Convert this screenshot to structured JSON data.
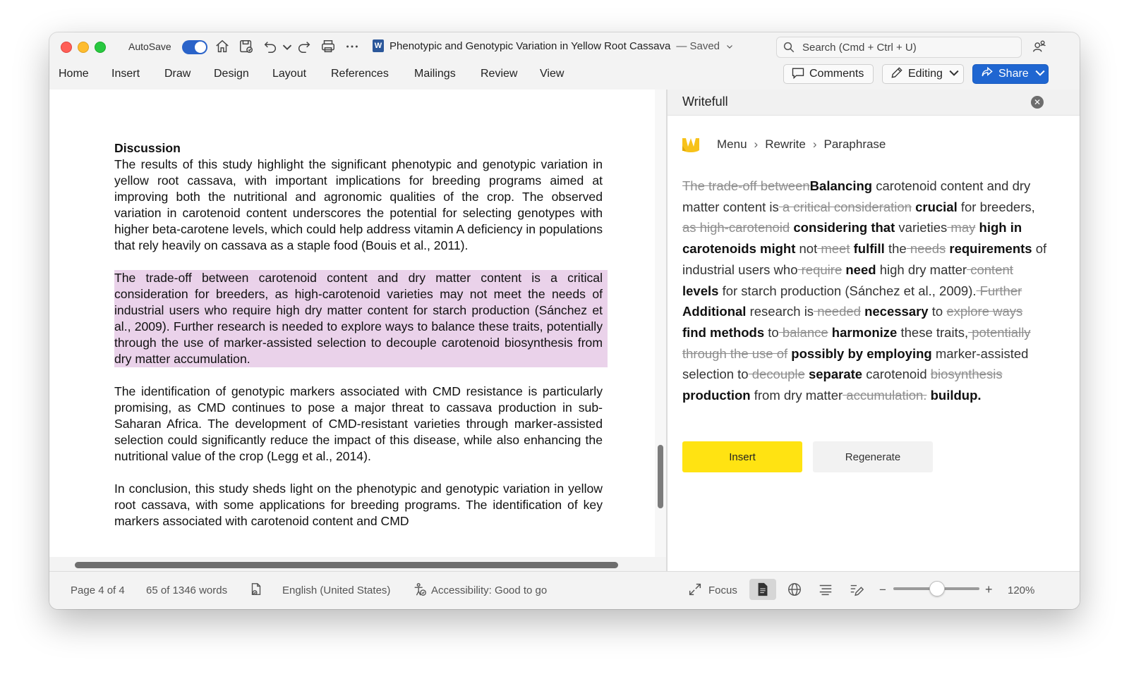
{
  "titlebar": {
    "autosave_label": "AutoSave",
    "document_title": "Phenotypic and Genotypic Variation in Yellow Root Cassava",
    "save_status": "— Saved",
    "app_letter": "W",
    "search_placeholder": "Search (Cmd + Ctrl + U)"
  },
  "ribbon": {
    "tabs": [
      "Home",
      "Insert",
      "Draw",
      "Design",
      "Layout",
      "References",
      "Mailings",
      "Review",
      "View"
    ],
    "comments_label": "Comments",
    "editing_label": "Editing",
    "share_label": "Share"
  },
  "document": {
    "heading": "Discussion",
    "paragraphs": [
      "The results of this study highlight the significant phenotypic and genotypic variation in yellow root cassava, with important implications for breeding programs aimed at improving both the nutritional and agronomic qualities of the crop. The observed variation in carotenoid content underscores the potential for selecting genotypes with higher beta-carotene levels, which could help address vitamin A deficiency in populations that rely heavily on cassava as a staple food (Bouis et al., 2011).",
      "The trade-off between carotenoid content and dry matter content is a critical consideration for breeders, as high-carotenoid varieties may not meet the needs of industrial users who require high dry matter content for starch production (Sánchez et al., 2009). Further research is needed to explore ways to balance these traits, potentially through the use of marker-assisted selection to decouple carotenoid biosynthesis from dry matter accumulation.",
      "The identification of genotypic markers associated with CMD resistance is particularly promising, as CMD continues to pose a major threat to cassava production in sub-Saharan Africa. The development of CMD-resistant varieties through marker-assisted selection could significantly reduce the impact of this disease, while also enhancing the nutritional value of the crop (Legg et al., 2014).",
      "In conclusion, this study sheds light on the phenotypic and genotypic variation in yellow root cassava, with some applications for breeding programs. The identification of key markers associated with carotenoid content and CMD"
    ]
  },
  "writefull": {
    "title": "Writefull",
    "close_glyph": "✕",
    "breadcrumb": [
      "Menu",
      "Rewrite",
      "Paraphrase"
    ],
    "breadcrumb_sep": "›",
    "segments": [
      {
        "t": "The trade-off between",
        "k": "del"
      },
      {
        "t": "Balancing",
        "k": "ins"
      },
      {
        "t": " carotenoid content and dry matter content is",
        "k": "keep"
      },
      {
        "t": " a critical consideration",
        "k": "del"
      },
      {
        "t": " crucial",
        "k": "ins"
      },
      {
        "t": " for breeders,",
        "k": "keep"
      },
      {
        "t": " as high-carotenoid",
        "k": "del"
      },
      {
        "t": " considering that",
        "k": "ins"
      },
      {
        "t": " varieties",
        "k": "keep"
      },
      {
        "t": " may",
        "k": "del"
      },
      {
        "t": " high in carotenoids might",
        "k": "ins"
      },
      {
        "t": " not",
        "k": "keep"
      },
      {
        "t": " meet",
        "k": "del"
      },
      {
        "t": " fulfill",
        "k": "ins"
      },
      {
        "t": " the",
        "k": "keep"
      },
      {
        "t": " needs",
        "k": "del"
      },
      {
        "t": " requirements",
        "k": "ins"
      },
      {
        "t": " of industrial users who",
        "k": "keep"
      },
      {
        "t": " require",
        "k": "del"
      },
      {
        "t": " need",
        "k": "ins"
      },
      {
        "t": " high dry matter",
        "k": "keep"
      },
      {
        "t": " content",
        "k": "del"
      },
      {
        "t": " levels",
        "k": "ins"
      },
      {
        "t": " for starch production (Sánchez et al., 2009).",
        "k": "keep"
      },
      {
        "t": " Further",
        "k": "del"
      },
      {
        "t": " Additional",
        "k": "ins"
      },
      {
        "t": " research is",
        "k": "keep"
      },
      {
        "t": " needed",
        "k": "del"
      },
      {
        "t": " necessary",
        "k": "ins"
      },
      {
        "t": " to ",
        "k": "keep"
      },
      {
        "t": "explore ways",
        "k": "del"
      },
      {
        "t": " find methods",
        "k": "ins"
      },
      {
        "t": " to",
        "k": "keep"
      },
      {
        "t": " balance",
        "k": "del"
      },
      {
        "t": " harmonize",
        "k": "ins"
      },
      {
        "t": " these traits,",
        "k": "keep"
      },
      {
        "t": " potentially through the use of",
        "k": "del"
      },
      {
        "t": " possibly by employing",
        "k": "ins"
      },
      {
        "t": " marker-assisted selection to",
        "k": "keep"
      },
      {
        "t": " decouple",
        "k": "del"
      },
      {
        "t": " separate",
        "k": "ins"
      },
      {
        "t": " carotenoid ",
        "k": "keep"
      },
      {
        "t": "biosynthesis",
        "k": "del"
      },
      {
        "t": " production",
        "k": "ins"
      },
      {
        "t": " from dry matter",
        "k": "keep"
      },
      {
        "t": " accumulation.",
        "k": "del"
      },
      {
        "t": " buildup.",
        "k": "ins"
      }
    ],
    "insert_label": "Insert",
    "regenerate_label": "Regenerate"
  },
  "statusbar": {
    "page": "Page 4 of 4",
    "words": "65 of 1346 words",
    "language": "English (United States)",
    "accessibility": "Accessibility: Good to go",
    "focus": "Focus",
    "zoom_minus": "−",
    "zoom_plus": "+",
    "zoom_level": "120%",
    "zoom_fraction": 0.5
  },
  "colors": {
    "accent": "#1f66d1",
    "highlight": "#ead2ea",
    "insert_button": "#ffe312",
    "writefull_logo": "#f7c21a"
  },
  "icons": [
    "home-icon",
    "save-icon",
    "undo-icon",
    "redo-icon",
    "print-icon",
    "more-icon",
    "search-icon",
    "person-share-icon",
    "comment-icon",
    "pencil-icon",
    "share-arrow-icon",
    "close-icon",
    "writefull-logo-icon",
    "document-check-icon",
    "accessibility-icon",
    "focus-icon",
    "print-layout-icon",
    "web-layout-icon",
    "outline-icon",
    "draft-icon"
  ]
}
